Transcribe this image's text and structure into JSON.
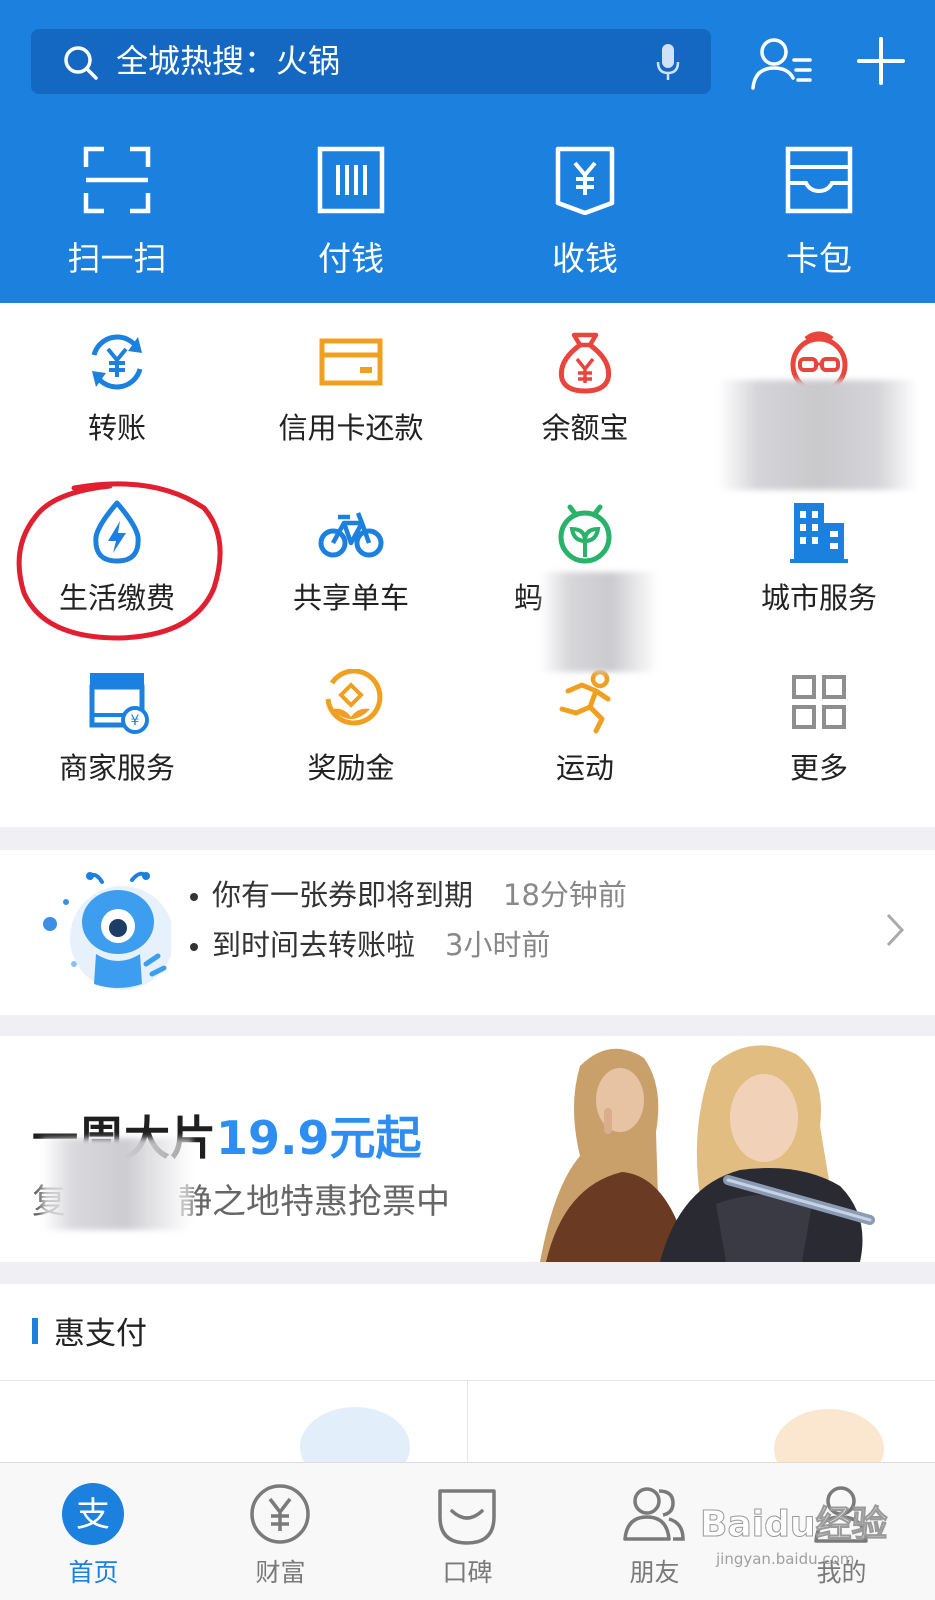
{
  "colors": {
    "brand_blue": "#1c80de",
    "orange": "#f0a020",
    "red": "#e8453c",
    "green": "#29b26a",
    "highlight_ring": "#e02030"
  },
  "header": {
    "search": {
      "placeholder": "全城热搜：火锅"
    },
    "quick_actions": [
      {
        "label": "扫一扫",
        "icon": "scan-icon"
      },
      {
        "label": "付钱",
        "icon": "barcode-icon"
      },
      {
        "label": "收钱",
        "icon": "receive-money-icon"
      },
      {
        "label": "卡包",
        "icon": "card-wallet-icon"
      }
    ]
  },
  "grid": {
    "items": [
      {
        "label": "转账",
        "icon": "transfer-icon"
      },
      {
        "label": "信用卡还款",
        "icon": "credit-card-icon"
      },
      {
        "label": "余额宝",
        "icon": "money-bag-icon"
      },
      {
        "label": "",
        "icon": "cartoon-face-icon"
      },
      {
        "label": "生活缴费",
        "icon": "utility-drop-icon"
      },
      {
        "label": "共享单车",
        "icon": "bicycle-icon"
      },
      {
        "label": "蚂",
        "icon": "sprout-icon"
      },
      {
        "label": "城市服务",
        "icon": "building-icon"
      },
      {
        "label": "商家服务",
        "icon": "shop-icon"
      },
      {
        "label": "奖励金",
        "icon": "reward-icon"
      },
      {
        "label": "运动",
        "icon": "running-icon"
      },
      {
        "label": "更多",
        "icon": "more-grid-icon"
      }
    ]
  },
  "notice": {
    "items": [
      {
        "text": "你有一张券即将到期",
        "time": "18分钟前"
      },
      {
        "text": "到时间去转账啦",
        "time": "3小时前"
      }
    ]
  },
  "banner": {
    "title": "一周大片",
    "highlight": "19.9元起",
    "subtitle_start": "复",
    "subtitle_end": "静之地特惠抢票中"
  },
  "section": {
    "title": "惠支付"
  },
  "tabbar": {
    "items": [
      {
        "label": "首页",
        "icon": "alipay-home-icon",
        "active": true
      },
      {
        "label": "财富",
        "icon": "wealth-icon",
        "active": false
      },
      {
        "label": "口碑",
        "icon": "koubei-icon",
        "active": false
      },
      {
        "label": "朋友",
        "icon": "friends-icon",
        "active": false
      },
      {
        "label": "我的",
        "icon": "profile-icon",
        "active": false
      }
    ]
  },
  "watermark": {
    "text": "Baidu经验",
    "sub": "jingyan.baidu.com"
  }
}
